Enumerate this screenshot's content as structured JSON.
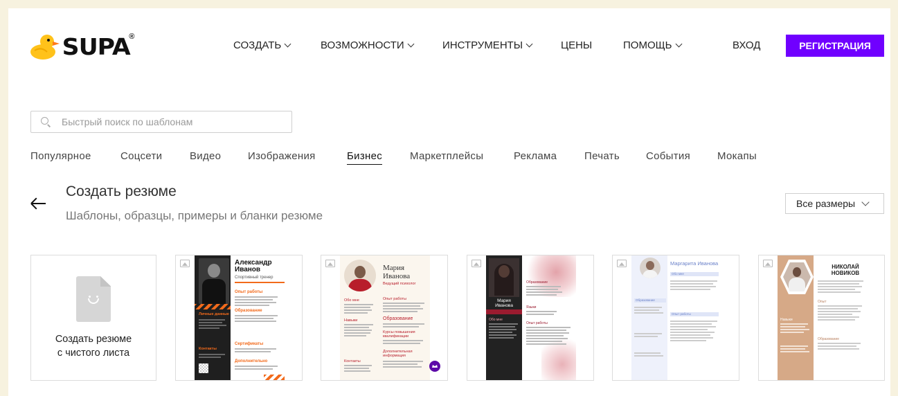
{
  "brand": {
    "name": "SUPA",
    "reg": "®"
  },
  "nav": [
    {
      "label": "СОЗДАТЬ",
      "dropdown": true
    },
    {
      "label": "ВОЗМОЖНОСТИ",
      "dropdown": true
    },
    {
      "label": "ИНСТРУМЕНТЫ",
      "dropdown": true
    },
    {
      "label": "ЦЕНЫ",
      "dropdown": false
    },
    {
      "label": "ПОМОЩЬ",
      "dropdown": true
    }
  ],
  "auth": {
    "login": "ВХОД",
    "register": "РЕГИСТРАЦИЯ"
  },
  "colors": {
    "accent": "#7000ff",
    "background": "#f7f2df"
  },
  "search": {
    "placeholder": "Быстрый поиск по шаблонам",
    "value": ""
  },
  "categories": [
    "Популярное",
    "Соцсети",
    "Видео",
    "Изображения",
    "Бизнес",
    "Маркетплейсы",
    "Реклама",
    "Печать",
    "События",
    "Мокапы"
  ],
  "active_category": "Бизнес",
  "heading": {
    "title": "Создать резюме",
    "subtitle": "Шаблоны, образцы, примеры и бланки резюме"
  },
  "size_filter": {
    "selected": "Все размеры"
  },
  "blank_card": {
    "line1": "Создать резюме",
    "line2": "с чистого листа"
  },
  "templates": [
    {
      "name": "Александр Иванов",
      "role": "Спортивный тренер",
      "sections": [
        "Опыт работы",
        "Образование",
        "Сертификаты",
        "Дополнительно",
        "Личные данные",
        "Контакты"
      ]
    },
    {
      "name": "Мария Иванова",
      "role": "Ведущий психолог",
      "sections": [
        "Обо мне",
        "Опыт работы",
        "Навыки",
        "Образование",
        "Курсы повышения квалификации",
        "Дополнительная информация",
        "Контакты"
      ]
    },
    {
      "name": "Мария Иванова",
      "sections": [
        "Обо мне",
        "Образование",
        "Опыт работы",
        "Языки"
      ]
    },
    {
      "name": "Маргарита Иванова",
      "sections": [
        "Обо мне",
        "Образование",
        "Опыт работы"
      ]
    },
    {
      "name": "НИКОЛАЙ НОВИКОВ",
      "sections": [
        "Опыт",
        "Образование",
        "Навыки"
      ]
    }
  ]
}
